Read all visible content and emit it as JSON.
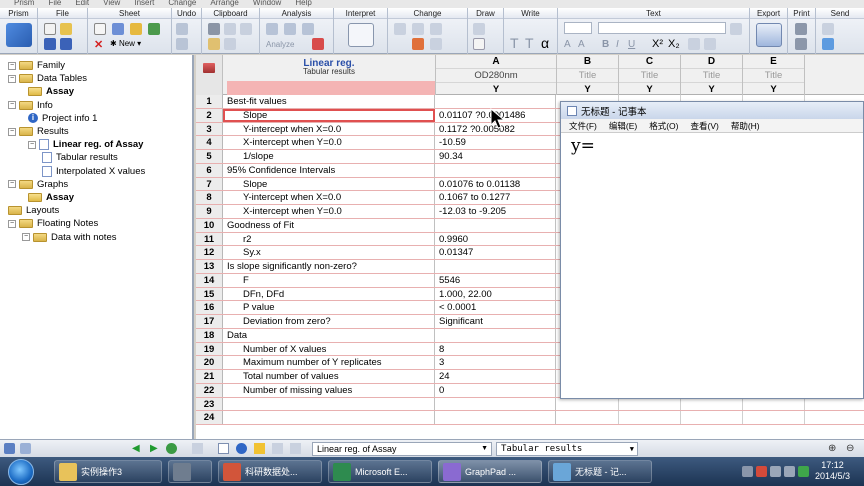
{
  "menu": [
    "Prism",
    "File",
    "Edit",
    "View",
    "Insert",
    "Change",
    "Arrange",
    "Window",
    "Help"
  ],
  "ribbon": {
    "groups": [
      "Prism",
      "File",
      "Sheet",
      "Undo",
      "Clipboard",
      "Analysis",
      "Interpret",
      "Change",
      "Draw",
      "Write",
      "Text",
      "Export",
      "Print",
      "Send"
    ],
    "new_label": "New",
    "analyze_label": "Analyze"
  },
  "navigator": {
    "items": [
      {
        "label": "Family",
        "type": "folder",
        "bold": false
      },
      {
        "label": "Data Tables",
        "type": "folder",
        "bold": false
      },
      {
        "label": "Assay",
        "type": "sheet",
        "bold": true
      },
      {
        "label": "Info",
        "type": "folder",
        "bold": false
      },
      {
        "label": "Project info 1",
        "type": "info",
        "bold": false
      },
      {
        "label": "Results",
        "type": "folder",
        "bold": false
      },
      {
        "label": "Linear reg. of Assay",
        "type": "doc",
        "bold": true
      },
      {
        "label": "Tabular results",
        "type": "doc",
        "bold": false
      },
      {
        "label": "Interpolated X values",
        "type": "doc",
        "bold": false
      },
      {
        "label": "Graphs",
        "type": "folder",
        "bold": false
      },
      {
        "label": "Assay",
        "type": "graph",
        "bold": true
      },
      {
        "label": "Layouts",
        "type": "folder",
        "bold": false
      },
      {
        "label": "Floating Notes",
        "type": "folder",
        "bold": false
      },
      {
        "label": "Data with notes",
        "type": "folder",
        "bold": false
      }
    ]
  },
  "sheet": {
    "corner_title": "Linear reg.",
    "corner_subtitle": "Tabular results",
    "columns": [
      {
        "letter": "A",
        "title": "OD280nm",
        "sub": "Y"
      },
      {
        "letter": "B",
        "title": "Title",
        "sub": "Y"
      },
      {
        "letter": "C",
        "title": "Title",
        "sub": "Y"
      },
      {
        "letter": "D",
        "title": "Title",
        "sub": "Y"
      },
      {
        "letter": "E",
        "title": "Title",
        "sub": "Y"
      }
    ],
    "rows": [
      {
        "n": "1",
        "label": "Best-fit values",
        "value": "",
        "indent": false
      },
      {
        "n": "2",
        "label": "Slope",
        "value": "0.01107 ?0.0001486",
        "indent": true
      },
      {
        "n": "3",
        "label": "Y-intercept when X=0.0",
        "value": "0.1172 ?0.005082",
        "indent": true
      },
      {
        "n": "4",
        "label": "X-intercept when Y=0.0",
        "value": "-10.59",
        "indent": true
      },
      {
        "n": "5",
        "label": "1/slope",
        "value": "90.34",
        "indent": true
      },
      {
        "n": "6",
        "label": "95% Confidence Intervals",
        "value": "",
        "indent": false
      },
      {
        "n": "7",
        "label": "Slope",
        "value": "0.01076 to 0.01138",
        "indent": true
      },
      {
        "n": "8",
        "label": "Y-intercept when X=0.0",
        "value": "0.1067 to 0.1277",
        "indent": true
      },
      {
        "n": "9",
        "label": "X-intercept when Y=0.0",
        "value": "-12.03 to -9.205",
        "indent": true
      },
      {
        "n": "10",
        "label": "Goodness of Fit",
        "value": "",
        "indent": false
      },
      {
        "n": "11",
        "label": "r2",
        "value": "0.9960",
        "indent": true
      },
      {
        "n": "12",
        "label": "Sy.x",
        "value": "0.01347",
        "indent": true
      },
      {
        "n": "13",
        "label": "Is slope significantly non-zero?",
        "value": "",
        "indent": false
      },
      {
        "n": "14",
        "label": "F",
        "value": "5546",
        "indent": true
      },
      {
        "n": "15",
        "label": "DFn, DFd",
        "value": "1.000, 22.00",
        "indent": true
      },
      {
        "n": "16",
        "label": "P value",
        "value": "< 0.0001",
        "indent": true
      },
      {
        "n": "17",
        "label": "Deviation from zero?",
        "value": "Significant",
        "indent": true
      },
      {
        "n": "18",
        "label": "Data",
        "value": "",
        "indent": false
      },
      {
        "n": "19",
        "label": "Number of X values",
        "value": "8",
        "indent": true
      },
      {
        "n": "20",
        "label": "Maximum number of Y replicates",
        "value": "3",
        "indent": true
      },
      {
        "n": "21",
        "label": "Total number of values",
        "value": "24",
        "indent": true
      },
      {
        "n": "22",
        "label": "Number of missing values",
        "value": "0",
        "indent": true
      },
      {
        "n": "23",
        "label": "",
        "value": "",
        "indent": false
      },
      {
        "n": "24",
        "label": "",
        "value": "",
        "indent": false
      }
    ]
  },
  "notepad": {
    "title": "无标题 - 记事本",
    "menu": [
      "文件(F)",
      "编辑(E)",
      "格式(O)",
      "查看(V)",
      "帮助(H)"
    ],
    "text": "y="
  },
  "bottombar": {
    "sheet_select": "Linear reg. of Assay",
    "view_select": "Tabular results"
  },
  "taskbar": {
    "buttons": [
      {
        "label": "实例操作3",
        "color": "#e8c25a"
      },
      {
        "label": "",
        "color": "#6f7d8f"
      },
      {
        "label": "科研数据处...",
        "color": "#d2553a"
      },
      {
        "label": "Microsoft E...",
        "color": "#2e8b4f"
      },
      {
        "label": "GraphPad ...",
        "color": "#8a6ad1"
      },
      {
        "label": "无标题 - 记...",
        "color": "#6aa6d8"
      }
    ],
    "time": "17:12",
    "date": "2014/5/3"
  }
}
